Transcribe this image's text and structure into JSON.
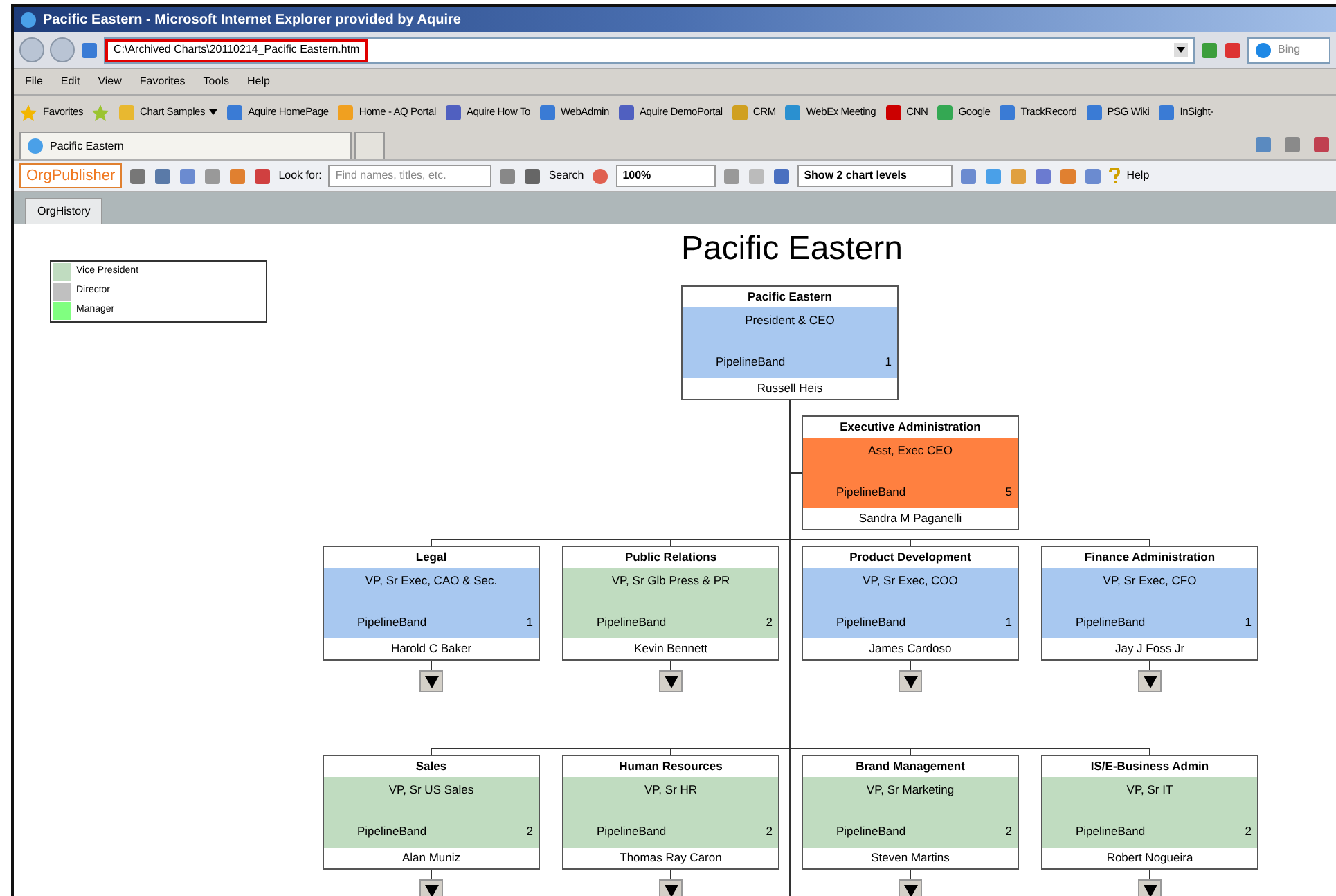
{
  "window": {
    "title": "Pacific Eastern - Microsoft Internet Explorer provided by Aquire"
  },
  "address": {
    "value": "C:\\Archived Charts\\20110214_Pacific Eastern.htm"
  },
  "search": {
    "placeholder": "Bing"
  },
  "menu": [
    "File",
    "Edit",
    "View",
    "Favorites",
    "Tools",
    "Help"
  ],
  "favorites": {
    "label": "Favorites",
    "items": [
      {
        "label": "Chart Samples",
        "menu": true
      },
      {
        "label": "Aquire HomePage",
        "menu": false
      },
      {
        "label": "Home - AQ Portal",
        "menu": false
      },
      {
        "label": "Aquire How To",
        "menu": false
      },
      {
        "label": "WebAdmin",
        "menu": false
      },
      {
        "label": "Aquire DemoPortal",
        "menu": false
      },
      {
        "label": "CRM",
        "menu": false
      },
      {
        "label": "WebEx Meeting",
        "menu": false
      },
      {
        "label": "CNN",
        "menu": false
      },
      {
        "label": "Google",
        "menu": false
      },
      {
        "label": "TrackRecord",
        "menu": false
      },
      {
        "label": "PSG Wiki",
        "menu": false
      },
      {
        "label": "InSight-",
        "menu": false
      }
    ]
  },
  "tab": {
    "label": "Pacific Eastern"
  },
  "toolbar": {
    "logo": "OrgPublisher",
    "look_for": "Look for:",
    "find": {
      "placeholder": "Find names, titles, etc."
    },
    "search": "Search",
    "zoom": "100%",
    "levels": "Show 2 chart levels",
    "help": "Help"
  },
  "page_tab": {
    "label": "OrgHistory",
    "selected": true
  },
  "chart": {
    "title": "Pacific Eastern",
    "legend": [
      {
        "label": "Vice President",
        "color": "#c0dcc0"
      },
      {
        "label": "Director",
        "color": "#c0c0c0"
      },
      {
        "label": "Manager",
        "color": "#80ff80"
      }
    ],
    "root": {
      "department": "Pacific Eastern",
      "title": "President & CEO",
      "band": "PipelineBand",
      "count": "1",
      "name": "Russell Heis",
      "color": "#a8c8f0",
      "expandable": false
    },
    "assistant": {
      "department": "Executive Administration",
      "title": "Asst, Exec CEO",
      "band": "PipelineBand",
      "count": "5",
      "name": "Sandra M Paganelli",
      "color": "#ff8040",
      "expandable": false
    },
    "rows": [
      [
        {
          "department": "Legal",
          "title": "VP, Sr Exec, CAO & Sec.",
          "band": "PipelineBand",
          "count": "1",
          "name": "Harold C Baker",
          "color": "#a8c8f0",
          "expandable": true
        },
        {
          "department": "Public Relations",
          "title": "VP, Sr Glb Press & PR",
          "band": "PipelineBand",
          "count": "2",
          "name": "Kevin Bennett",
          "color": "#c0dcc0",
          "expandable": true
        },
        {
          "department": "Product Development",
          "title": "VP, Sr Exec, COO",
          "band": "PipelineBand",
          "count": "1",
          "name": "James Cardoso",
          "color": "#a8c8f0",
          "expandable": true
        },
        {
          "department": "Finance Administration",
          "title": "VP, Sr Exec, CFO",
          "band": "PipelineBand",
          "count": "1",
          "name": "Jay J Foss Jr",
          "color": "#a8c8f0",
          "expandable": true
        }
      ],
      [
        {
          "department": "Sales",
          "title": "VP, Sr US Sales",
          "band": "PipelineBand",
          "count": "2",
          "name": "Alan Muniz",
          "color": "#c0dcc0",
          "expandable": true
        },
        {
          "department": "Human Resources",
          "title": "VP, Sr HR",
          "band": "PipelineBand",
          "count": "2",
          "name": "Thomas Ray Caron",
          "color": "#c0dcc0",
          "expandable": true
        },
        {
          "department": "Brand Management",
          "title": "VP, Sr Marketing",
          "band": "PipelineBand",
          "count": "2",
          "name": "Steven Martins",
          "color": "#c0dcc0",
          "expandable": true
        },
        {
          "department": "IS/E-Business Admin",
          "title": "VP, Sr IT",
          "band": "PipelineBand",
          "count": "2",
          "name": "Robert Nogueira",
          "color": "#c0dcc0",
          "expandable": true
        }
      ]
    ]
  }
}
